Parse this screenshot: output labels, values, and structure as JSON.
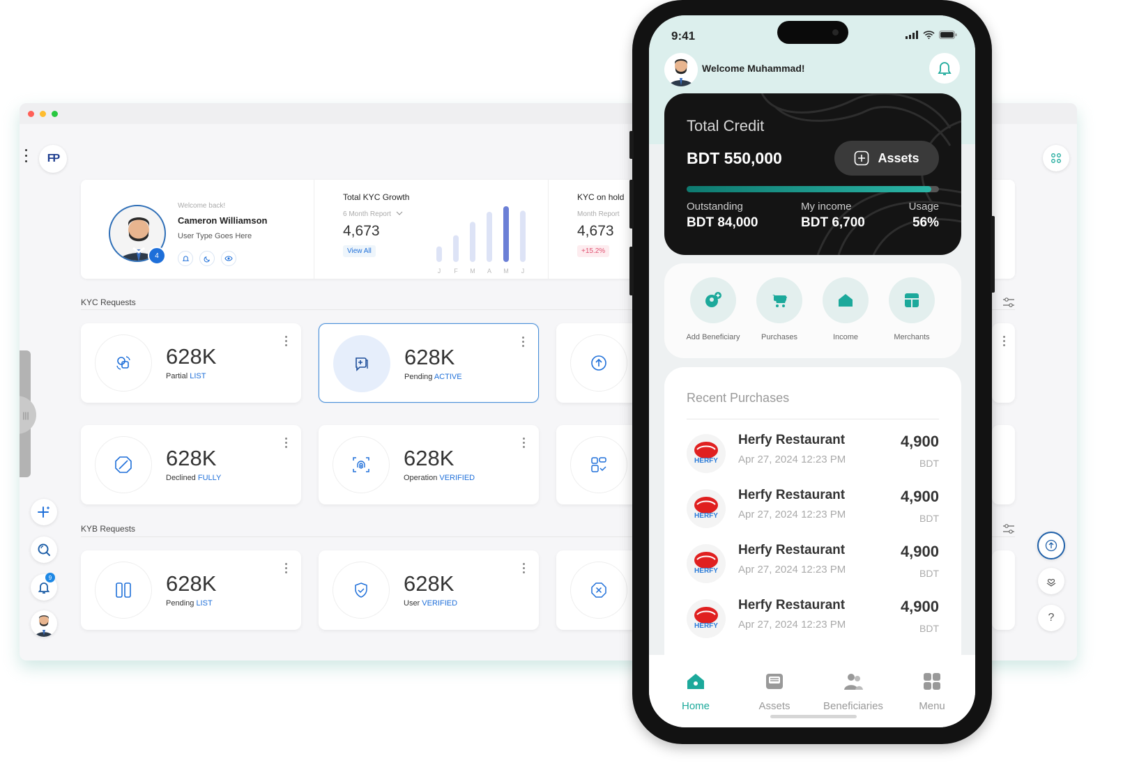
{
  "desktop": {
    "logo": "FP",
    "profile": {
      "welcome": "Welcome back!",
      "name": "Cameron Williamson",
      "user_type": "User Type Goes Here",
      "badge": "4"
    },
    "kyc_growth": {
      "title": "Total KYC Growth",
      "period": "6 Month Report",
      "value": "4,673",
      "link": "View All",
      "months": [
        "J",
        "F",
        "M",
        "A",
        "M",
        "J"
      ],
      "bar_levels": [
        0.28,
        0.48,
        0.72,
        0.9,
        1.0,
        0.92
      ]
    },
    "kyc_hold": {
      "title": "KYC on hold",
      "period": "Month Report",
      "value": "4,673",
      "change": "+15.2%"
    },
    "kyc_section": "KYC Requests",
    "kyb_section": "KYB Requests",
    "cards": [
      {
        "value": "628K",
        "label": "Partial",
        "tag": "LIST",
        "icon": "swap-circles-icon"
      },
      {
        "value": "628K",
        "label": "Pending",
        "tag": "ACTIVE",
        "icon": "chat-plus-icon"
      },
      {
        "value": "628K",
        "label": "Declined",
        "tag": "FULLY",
        "icon": "block-icon"
      },
      {
        "value": "628K",
        "label": "Operation",
        "tag": "VERIFIED",
        "icon": "fingerprint-icon"
      },
      {
        "value": "628K",
        "label": "Pending",
        "tag": "LIST",
        "icon": "columns-icon"
      },
      {
        "value": "628K",
        "label": "User",
        "tag": "VERIFIED",
        "icon": "shield-check-icon"
      }
    ],
    "notification_count": "9",
    "help_label": "?"
  },
  "phone": {
    "time": "9:41",
    "welcome": "Welcome Muhammad!",
    "card": {
      "title": "Total Credit",
      "amount": "BDT 550,000",
      "assets_button": "Assets",
      "usage_fraction": 0.97,
      "outstanding_label": "Outstanding",
      "outstanding_value": "BDT 84,000",
      "income_label": "My income",
      "income_value": "BDT 6,700",
      "usage_label": "Usage",
      "usage_value": "56%"
    },
    "quick_actions": [
      {
        "label": "Add Beneficiary",
        "icon": "add-user-icon"
      },
      {
        "label": "Purchases",
        "icon": "cart-icon"
      },
      {
        "label": "Income",
        "icon": "wallet-icon"
      },
      {
        "label": "Merchants",
        "icon": "store-icon"
      }
    ],
    "recent_title": "Recent Purchases",
    "purchases": [
      {
        "name": "Herfy Restaurant",
        "date": "Apr 27, 2024 12:23 PM",
        "amount": "4,900",
        "currency": "BDT",
        "logo_text": "HERFY"
      },
      {
        "name": "Herfy Restaurant",
        "date": "Apr 27, 2024 12:23 PM",
        "amount": "4,900",
        "currency": "BDT",
        "logo_text": "HERFY"
      },
      {
        "name": "Herfy Restaurant",
        "date": "Apr 27, 2024 12:23 PM",
        "amount": "4,900",
        "currency": "BDT",
        "logo_text": "HERFY"
      },
      {
        "name": "Herfy Restaurant",
        "date": "Apr 27, 2024 12:23 PM",
        "amount": "4,900",
        "currency": "BDT",
        "logo_text": "HERFY"
      }
    ],
    "tabs": [
      {
        "label": "Home",
        "icon": "home-icon",
        "active": true
      },
      {
        "label": "Assets",
        "icon": "inbox-icon",
        "active": false
      },
      {
        "label": "Beneficiaries",
        "icon": "users-icon",
        "active": false
      },
      {
        "label": "Menu",
        "icon": "grid-icon",
        "active": false
      }
    ],
    "colors": {
      "accent": "#1ca99b",
      "card_bg": "#141414",
      "desktop_accent": "#1e6fd9"
    }
  }
}
